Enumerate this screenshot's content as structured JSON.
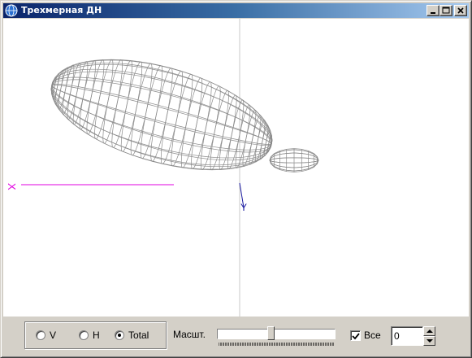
{
  "window": {
    "title": "Трехмерная ДН",
    "icon": "globe-icon",
    "controls": [
      "minimize-icon",
      "maximize-icon",
      "close-icon"
    ]
  },
  "viewport": {
    "axis_x_label": "X",
    "axis_y_label": "Y",
    "colors": {
      "mesh": "#8a8a8a",
      "x_axis": "#e000e0",
      "y_axis": "#1a1aa0",
      "z_axis": "#c0c0c0"
    }
  },
  "controls": {
    "radios": [
      {
        "label": "V",
        "selected": false
      },
      {
        "label": "H",
        "selected": false
      },
      {
        "label": "Total",
        "selected": true
      }
    ],
    "scale_label": "Масшт.",
    "scale_level": 0.45,
    "all_label": "Все",
    "all_checked": true,
    "spin_value": "0"
  }
}
